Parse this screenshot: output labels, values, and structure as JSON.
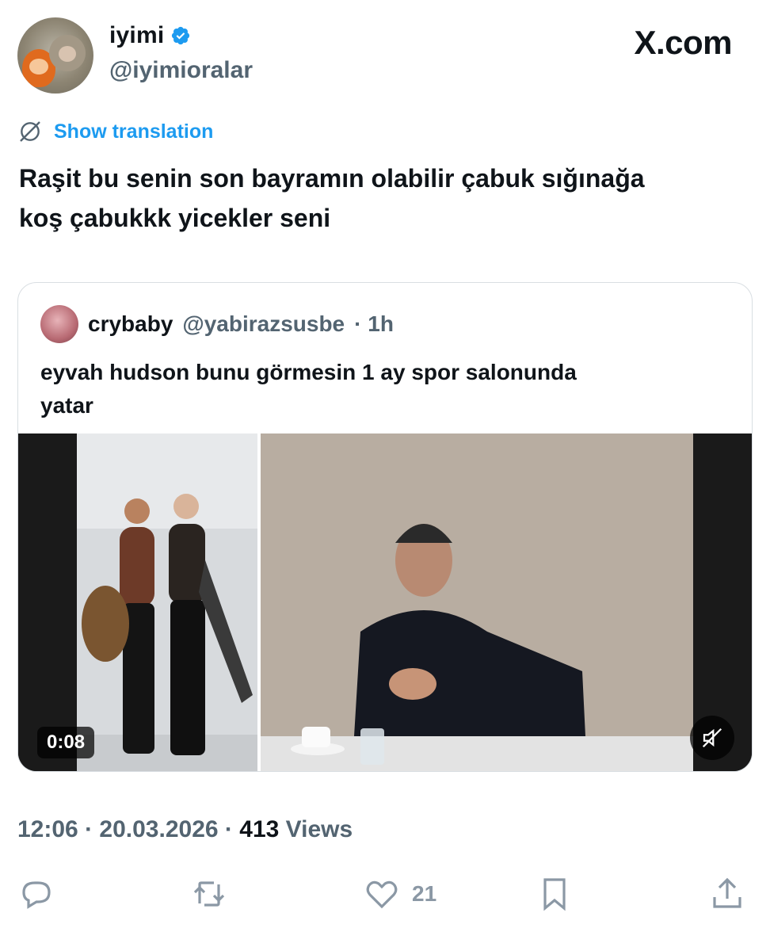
{
  "post": {
    "display_name": "iyimi",
    "handle": "@iyimioralar",
    "site_label": "X.com",
    "translate_label": "Show translation",
    "text_line1": "Raşit bu senin son bayramın olabilir çabuk sığınağa",
    "text_line2": "koş çabukkk yicekler seni",
    "time": "12:06",
    "date": "20.03.2026",
    "separator": "·",
    "views_count": "413",
    "views_label": "Views"
  },
  "quote": {
    "display_name": "crybaby",
    "handle": "@yabirazsusbe",
    "age": "· 1h",
    "text_line1": "eyvah hudson bunu görmesin 1 ay spor salonunda",
    "text_line2": "yatar",
    "video_duration": "0:08"
  },
  "actions": {
    "reply_count": "",
    "repost_count": "",
    "like_count": "21",
    "bookmark_count": ""
  },
  "colors": {
    "accent": "#1d9bf0",
    "text": "#0f1419",
    "muted": "#536471",
    "icon": "#8b98a5"
  }
}
